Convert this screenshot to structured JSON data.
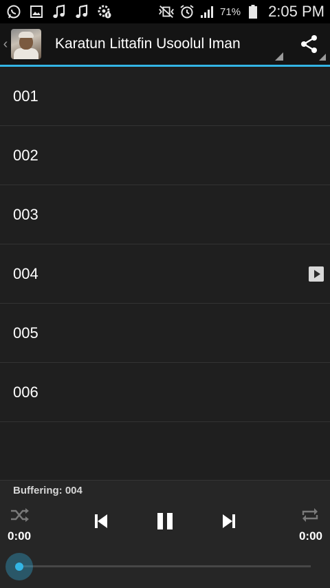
{
  "status_bar": {
    "icons_left": [
      "whatsapp-icon",
      "image-icon",
      "music-note-icon",
      "music-note-icon",
      "settings-notification-icon"
    ],
    "icons_right": [
      "mute-vibrate-icon",
      "alarm-icon",
      "signal-icon",
      "battery-icon"
    ],
    "battery_percent": "71%",
    "time": "2:05 PM"
  },
  "action_bar": {
    "title": "Karatun Littafin Usoolul Iman",
    "share_icon": "share-icon",
    "accent_color": "#33b5e5"
  },
  "tracks": [
    {
      "label": "001",
      "playing": false
    },
    {
      "label": "002",
      "playing": false
    },
    {
      "label": "003",
      "playing": false
    },
    {
      "label": "004",
      "playing": true
    },
    {
      "label": "005",
      "playing": false
    },
    {
      "label": "006",
      "playing": false
    }
  ],
  "player": {
    "buffering_text": "Buffering: 004",
    "elapsed": "0:00",
    "duration": "0:00",
    "progress": 0,
    "controls": [
      "shuffle-icon",
      "previous-icon",
      "pause-icon",
      "next-icon",
      "repeat-icon"
    ]
  }
}
